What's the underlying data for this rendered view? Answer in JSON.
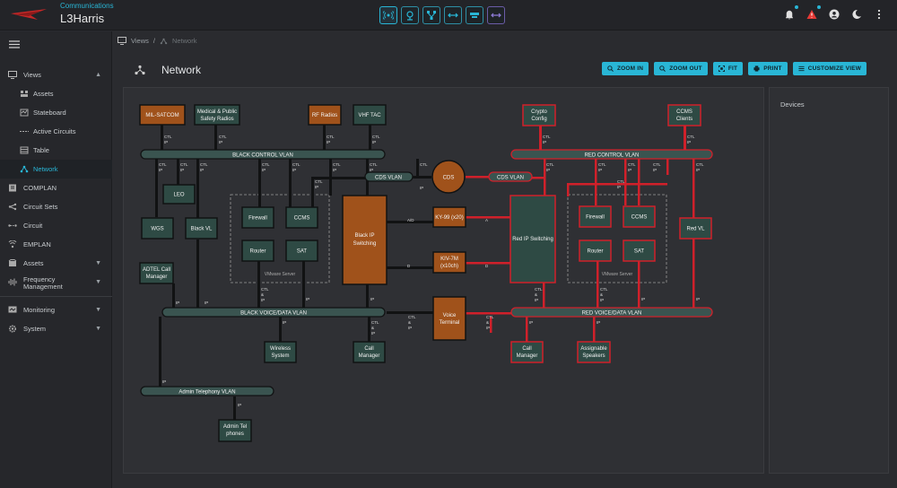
{
  "header": {
    "subtitle": "Communications",
    "title": "L3Harris",
    "brand_color": "#c62828",
    "accent_color": "#29b6d6"
  },
  "view_buttons": [
    "network-view-icon",
    "map-pin-icon",
    "topology-icon",
    "split-arrows-icon",
    "server-rack-icon",
    "purple-arrows-icon"
  ],
  "sidebar": {
    "items": [
      {
        "label": "Views",
        "icon": "monitor-icon",
        "expanded": true
      },
      {
        "label": "Assets",
        "icon": "assets-icon",
        "sub": true
      },
      {
        "label": "Stateboard",
        "icon": "stateboard-icon",
        "sub": true
      },
      {
        "label": "Active Circuits",
        "icon": "circuits-icon",
        "sub": true
      },
      {
        "label": "Table",
        "icon": "table-icon",
        "sub": true
      },
      {
        "label": "Network",
        "icon": "network-icon",
        "sub": true,
        "active": true
      },
      {
        "label": "COMPLAN",
        "icon": "complan-icon"
      },
      {
        "label": "Circuit Sets",
        "icon": "circuit-sets-icon"
      },
      {
        "label": "Circuit",
        "icon": "circuit-icon"
      },
      {
        "label": "EMPLAN",
        "icon": "emplan-icon"
      },
      {
        "label": "Assets",
        "icon": "box-icon",
        "chevron": true
      },
      {
        "label": "Frequency Management",
        "icon": "frequency-icon",
        "chevron": true
      },
      {
        "label": "Monitoring",
        "icon": "monitoring-icon",
        "chevron": true
      },
      {
        "label": "System",
        "icon": "gear-icon",
        "chevron": true
      }
    ]
  },
  "breadcrumb": {
    "root": "Views",
    "current": "Network"
  },
  "page": {
    "title": "Network"
  },
  "toolbar": {
    "zoom_in": "ZOOM IN",
    "zoom_out": "ZOOM OUT",
    "fit": "FIT",
    "print": "PRINT",
    "customize": "CUSTOMIZE VIEW"
  },
  "devices_panel": {
    "title": "Devices"
  },
  "diagram": {
    "colors": {
      "black_node": "#2e4a44",
      "orange_node": "#a0521b",
      "red_line": "#d0202a",
      "dark_line": "#121314",
      "vlan_fill": "#3a5450"
    },
    "nodes": {
      "mil_satcom": "MIL-SATCOM",
      "med_radios_1": "Medical & Public",
      "med_radios_2": "Safety Radios",
      "rf_radios": "RF Radios",
      "vhf_tac": "VHF TAC",
      "crypto_1": "Crypto",
      "crypto_2": "Config",
      "ccms_clients_1": "CCMS",
      "ccms_clients_2": "Clients",
      "leo": "LEO",
      "wgs": "WGS",
      "black_vl": "Black VL",
      "firewall_b": "Firewall",
      "ccms_b": "CCMS",
      "router_b": "Router",
      "sat_b": "SAT",
      "vmware_b": "VMware Server",
      "black_ip_1": "Black IP",
      "black_ip_2": "Switching",
      "cds": "CDS",
      "ky99": "KY-99 (x20)",
      "kiv7m_1": "KIV-7M",
      "kiv7m_2": "(x10ch)",
      "red_ip": "Red IP Switching",
      "firewall_r": "Firewall",
      "ccms_r": "CCMS",
      "router_r": "Router",
      "sat_r": "SAT",
      "vmware_r": "VMware Server",
      "red_vl": "Red VL",
      "adtel_1": "ADTEL Call",
      "adtel_2": "Manager",
      "voice_1": "Voice",
      "voice_2": "Terminal",
      "wireless_1": "Wireless",
      "wireless_2": "System",
      "call_mgr_b_1": "Call",
      "call_mgr_b_2": "Manager",
      "call_mgr_r_1": "Call",
      "call_mgr_r_2": "Manager",
      "speakers_1": "Assignable",
      "speakers_2": "Speakers",
      "admin_tel_1": "Admin Tel",
      "admin_tel_2": "phones"
    },
    "vlans": {
      "black_control": "BLACK CONTROL VLAN",
      "red_control": "RED CONTROL VLAN",
      "cds_vlan_b": "CDS VLAN",
      "cds_vlan_r": "CDS VLAN",
      "black_voice": "BLACK VOICE/DATA VLAN",
      "red_voice": "RED VOICE/DATA VLAN",
      "admin_tel": "Admin Telephony VLAN"
    },
    "link_labels": {
      "ctl": "CTL",
      "ip": "IP",
      "amp": "&",
      "a": "A",
      "d": "D",
      "a_d": "A/D"
    }
  }
}
